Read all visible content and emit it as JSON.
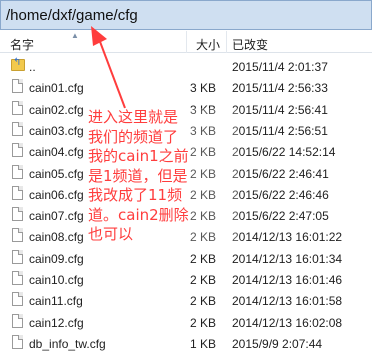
{
  "path": "/home/dxf/game/cfg",
  "columns": {
    "name": "名字",
    "size": "大小",
    "date": "已改变"
  },
  "rows": [
    {
      "name": "..",
      "size": "",
      "date": "2015/11/4 2:01:37",
      "type": "up"
    },
    {
      "name": "cain01.cfg",
      "size": "3 KB",
      "date": "2015/11/4 2:56:33",
      "type": "file"
    },
    {
      "name": "cain02.cfg",
      "size": "3 KB",
      "date": "2015/11/4 2:56:41",
      "type": "file"
    },
    {
      "name": "cain03.cfg",
      "size": "3 KB",
      "date": "2015/11/4 2:56:51",
      "type": "file"
    },
    {
      "name": "cain04.cfg",
      "size": "2 KB",
      "date": "2015/6/22 14:52:14",
      "type": "file"
    },
    {
      "name": "cain05.cfg",
      "size": "2 KB",
      "date": "2015/6/22 2:46:41",
      "type": "file"
    },
    {
      "name": "cain06.cfg",
      "size": "2 KB",
      "date": "2015/6/22 2:46:46",
      "type": "file"
    },
    {
      "name": "cain07.cfg",
      "size": "2 KB",
      "date": "2015/6/22 2:47:05",
      "type": "file"
    },
    {
      "name": "cain08.cfg",
      "size": "2 KB",
      "date": "2014/12/13 16:01:22",
      "type": "file"
    },
    {
      "name": "cain09.cfg",
      "size": "2 KB",
      "date": "2014/12/13 16:01:34",
      "type": "file"
    },
    {
      "name": "cain10.cfg",
      "size": "2 KB",
      "date": "2014/12/13 16:01:46",
      "type": "file"
    },
    {
      "name": "cain11.cfg",
      "size": "2 KB",
      "date": "2014/12/13 16:01:58",
      "type": "file"
    },
    {
      "name": "cain12.cfg",
      "size": "2 KB",
      "date": "2014/12/13 16:02:08",
      "type": "file"
    },
    {
      "name": "db_info_tw.cfg",
      "size": "1 KB",
      "date": "2015/9/9 2:07:44",
      "type": "file"
    }
  ],
  "annotation": {
    "lines": [
      "进入这里就是",
      "我们的频道了",
      "我的cain1之前",
      "是1频道，但是",
      "我改成了11频",
      "道。cain2删除",
      "也可以"
    ],
    "color": "#ff3d3d"
  }
}
